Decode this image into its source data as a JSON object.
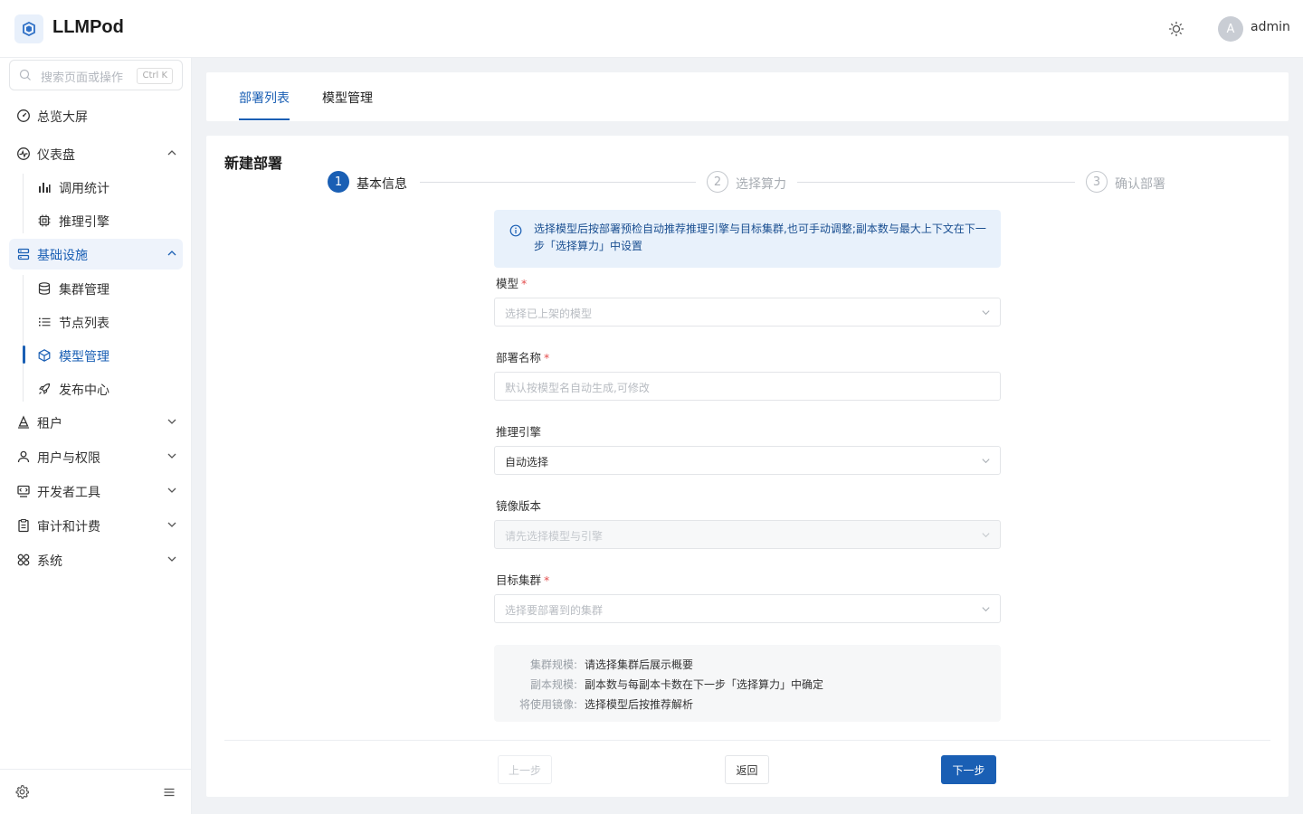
{
  "app": {
    "title": "LLMPod",
    "user": "admin",
    "avatar_letter": "A"
  },
  "search": {
    "placeholder": "搜索页面或操作",
    "shortcut": "Ctrl K"
  },
  "sidebar": {
    "items": [
      {
        "label": "总览大屏",
        "icon": "dashboard-gauge-icon"
      },
      {
        "label": "仪表盘",
        "icon": "activity-icon",
        "expanded": true
      },
      {
        "label": "调用统计",
        "icon": "bar-chart-icon"
      },
      {
        "label": "推理引擎",
        "icon": "chip-icon"
      },
      {
        "label": "基础设施",
        "icon": "server-icon",
        "expanded": true
      },
      {
        "label": "集群管理",
        "icon": "database-icon"
      },
      {
        "label": "节点列表",
        "icon": "list-icon"
      },
      {
        "label": "模型管理",
        "icon": "cube-icon",
        "active": true
      },
      {
        "label": "发布中心",
        "icon": "rocket-icon"
      },
      {
        "label": "租户",
        "icon": "tenant-icon"
      },
      {
        "label": "用户与权限",
        "icon": "user-icon"
      },
      {
        "label": "开发者工具",
        "icon": "devtools-icon"
      },
      {
        "label": "审计和计费",
        "icon": "clipboard-icon"
      },
      {
        "label": "系统",
        "icon": "grid-icon"
      }
    ]
  },
  "tabs": [
    {
      "label": "部署列表",
      "active": true
    },
    {
      "label": "模型管理"
    }
  ],
  "page": {
    "title": "新建部署"
  },
  "steps": [
    {
      "num": "1",
      "label": "基本信息",
      "active": true
    },
    {
      "num": "2",
      "label": "选择算力"
    },
    {
      "num": "3",
      "label": "确认部署"
    }
  ],
  "info": {
    "text": "选择模型后按部署预检自动推荐推理引擎与目标集群,也可手动调整;副本数与最大上下文在下一步「选择算力」中设置"
  },
  "form": {
    "model": {
      "label": "模型",
      "placeholder": "选择已上架的模型"
    },
    "name": {
      "label": "部署名称",
      "placeholder": "默认按模型名自动生成,可修改"
    },
    "engine": {
      "label": "推理引擎",
      "value": "自动选择"
    },
    "image": {
      "label": "镜像版本",
      "placeholder": "请先选择模型与引擎"
    },
    "cluster": {
      "label": "目标集群",
      "placeholder": "选择要部署到的集群"
    }
  },
  "summary": {
    "rows": [
      {
        "key": "集群规模:",
        "value": "请选择集群后展示概要"
      },
      {
        "key": "副本规模:",
        "value": "副本数与每副本卡数在下一步「选择算力」中确定"
      },
      {
        "key": "将使用镜像:",
        "value": "选择模型后按推荐解析"
      }
    ]
  },
  "buttons": {
    "prev": "上一步",
    "back": "返回",
    "next": "下一步"
  },
  "colors": {
    "primary": "#1a5fb4",
    "info_bg": "#e8f1fb",
    "required": "#e34d4d"
  }
}
